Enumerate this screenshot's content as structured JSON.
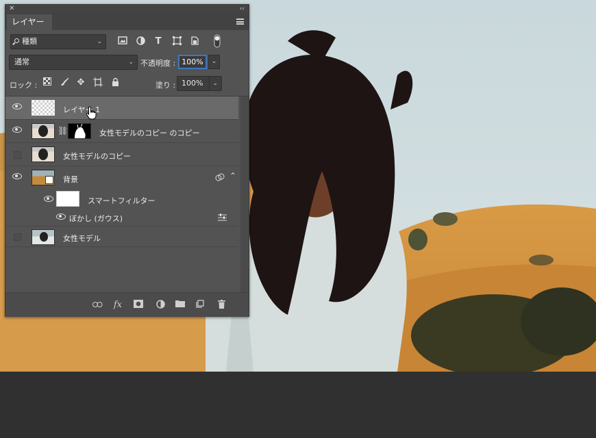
{
  "panel": {
    "tab_label": "レイヤー",
    "filter": {
      "label": "種類",
      "icons": [
        "image-filter-icon",
        "adjustment-filter-icon",
        "text-filter-icon",
        "shape-filter-icon",
        "smart-object-filter-icon",
        "filter-toggle-icon"
      ]
    },
    "blend_mode": "通常",
    "opacity_label": "不透明度 :",
    "opacity_value": "100%",
    "lock_label": "ロック :",
    "lock_icons": [
      "lock-transparent-icon",
      "lock-paint-icon",
      "lock-position-icon",
      "lock-artboard-icon",
      "lock-all-icon"
    ],
    "fill_label": "塗り :",
    "fill_value": "100%"
  },
  "layers": [
    {
      "name": "レイヤー 1",
      "visible": true,
      "selected": true,
      "thumb": "transparent"
    },
    {
      "name": "女性モデルのコピー のコピー",
      "visible": true,
      "selected": false,
      "thumb": "photo",
      "mask": true
    },
    {
      "name": "女性モデルのコピー",
      "visible": false,
      "selected": false,
      "thumb": "photo"
    },
    {
      "name": "背景",
      "visible": true,
      "selected": false,
      "thumb": "smart-object"
    },
    {
      "name": "スマートフィルター",
      "visible": true,
      "selected": false,
      "thumb": "white",
      "indent": 1
    },
    {
      "name": "ぼかし (ガウス)",
      "visible": true,
      "selected": false,
      "indent": 2
    },
    {
      "name": "女性モデル",
      "visible": false,
      "selected": false,
      "thumb": "photo"
    }
  ],
  "footer_icons": [
    "link-layers-icon",
    "fx-icon",
    "add-mask-icon",
    "adjustment-layer-icon",
    "new-group-icon",
    "new-layer-icon",
    "delete-icon"
  ],
  "footer_fx": "fx"
}
